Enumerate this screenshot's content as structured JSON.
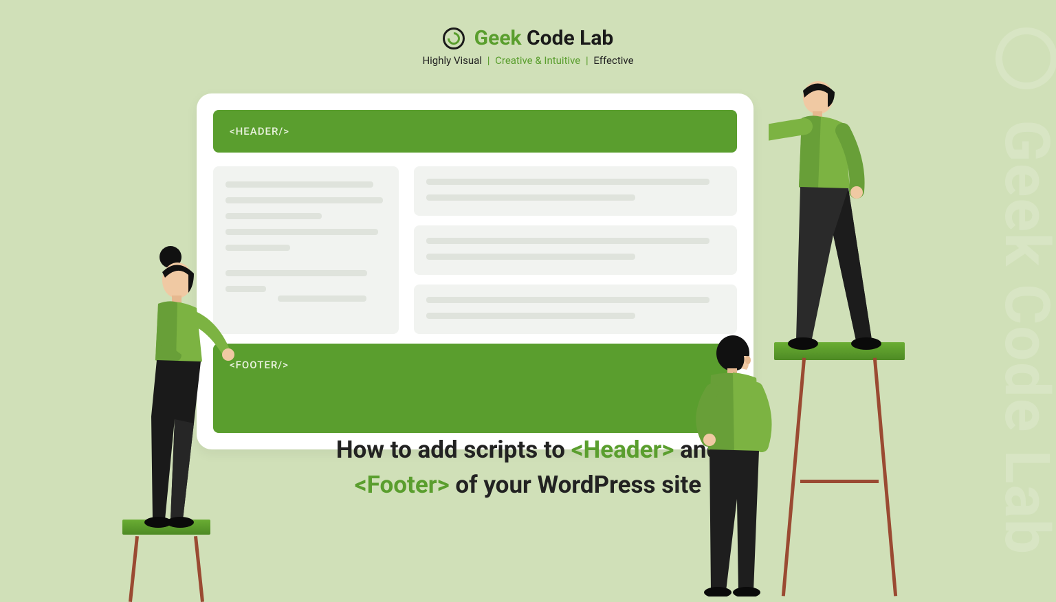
{
  "brand": {
    "name_part1": "Geek",
    "name_part2": "Code Lab",
    "tagline_part1": "Highly Visual",
    "tagline_highlight": "Creative & Intuitive",
    "tagline_part3": "Effective",
    "separator": "|"
  },
  "card": {
    "header_label": "<HEADER/>",
    "footer_label": "<FOOTER/>"
  },
  "headline": {
    "part1": "How to add scripts to ",
    "tag1": "<Header>",
    "part2": " and ",
    "tag2": "<Footer>",
    "part3": " of your WordPress site"
  },
  "watermark": "Geek Code Lab"
}
